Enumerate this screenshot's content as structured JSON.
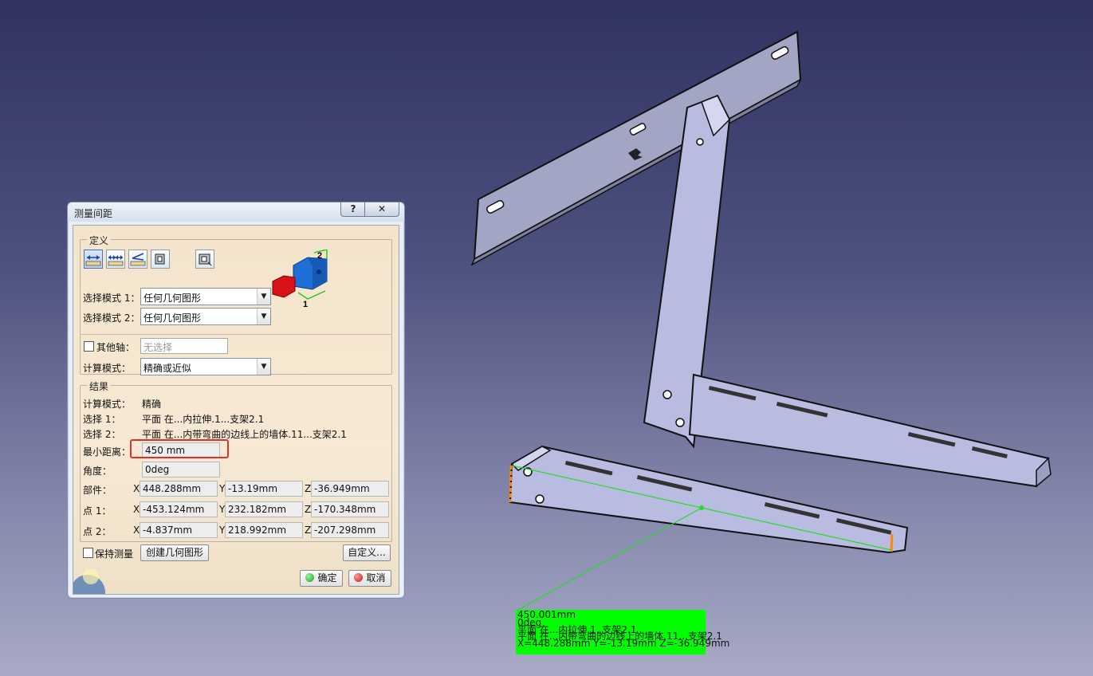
{
  "dialog": {
    "title": "测量间距",
    "help_label": "?",
    "close_label": "✕",
    "definition": {
      "group_title": "定义",
      "tool_icons": [
        "measure-between-icon",
        "measure-chain-icon",
        "measure-fan-icon",
        "measure-item-icon",
        "measure-inertia-icon"
      ],
      "select_mode_1_label": "选择模式 1：",
      "select_mode_1_value": "任何几何图形",
      "select_mode_2_label": "选择模式 2：",
      "select_mode_2_value": "任何几何图形",
      "other_axis_label": "其他轴：",
      "other_axis_value": "无选择",
      "calc_mode_label": "计算模式：",
      "calc_mode_value": "精确或近似",
      "preview_label_1": "1",
      "preview_label_2": "2"
    },
    "results": {
      "group_title": "结果",
      "calc_mode_label": "计算模式：",
      "calc_mode_value": "精确",
      "selection_1_label": "选择 1：",
      "selection_1_value": "平面 在...内拉伸.1...支架2.1",
      "selection_2_label": "选择 2：",
      "selection_2_value": "平面 在...内带弯曲的边线上的墙体.11...支架2.1",
      "min_distance_label": "最小距离：",
      "min_distance_value": "450  mm",
      "angle_label": "角度：",
      "angle_value": "0deg",
      "component_label": "部件：",
      "point1_label": "点 1：",
      "point2_label": "点 2：",
      "axis_x": "X",
      "axis_y": "Y",
      "axis_z": "Z",
      "component": {
        "x": "448.288mm",
        "y": "-13.19mm",
        "z": "-36.949mm"
      },
      "point1": {
        "x": "-453.124mm",
        "y": "232.182mm",
        "z": "-170.348mm"
      },
      "point2": {
        "x": "-4.837mm",
        "y": "218.992mm",
        "z": "-207.298mm"
      }
    },
    "keep_measure_label": "保持测量",
    "create_geometry_label": "创建几何图形",
    "customize_label": "自定义...",
    "ok_label": "确定",
    "cancel_label": "取消"
  },
  "callout": {
    "line1": "450.001mm",
    "line2": "0deg",
    "line3": "平面 在...内拉伸.1..支架2.1",
    "line4": "平面 在...内带弯曲的边线上的墙体.11...支架2.1",
    "line5": "X=448.288mm  Y=-13.19mm  Z=-36.949mm"
  },
  "colors": {
    "highlight_box": "#e0302a",
    "callout_bg": "#00ff00",
    "part_fill": "#b9bbe0",
    "measure_line": "#22dd22"
  }
}
